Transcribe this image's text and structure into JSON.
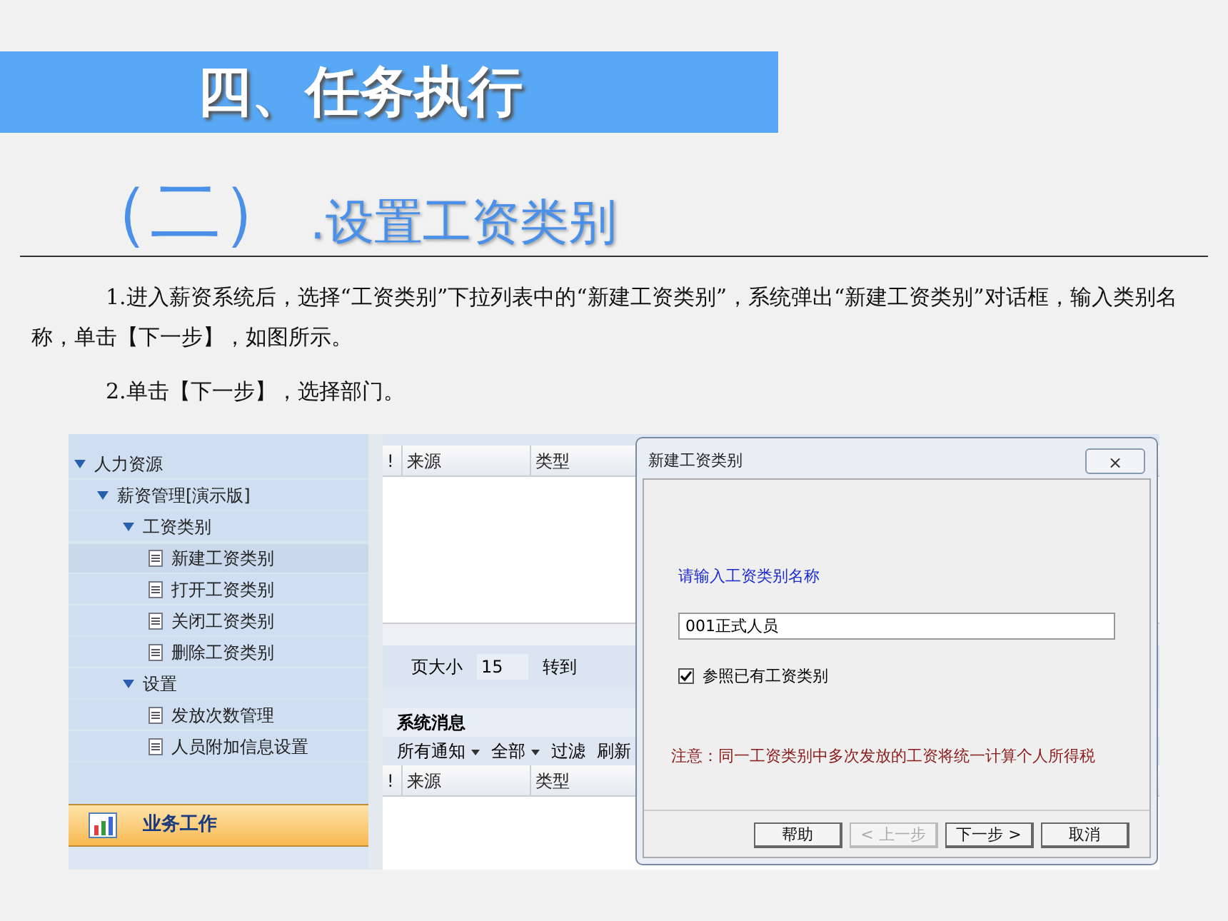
{
  "slide": {
    "title": "四、任务执行",
    "section_number": "（二）",
    "section_title": ".设置工资类别",
    "paragraphs": [
      "1.进入薪资系统后，选择“工资类别”下拉列表中的“新建工资类别”，系统弹出“新建工资类别”对话框，输入类别名称，单击【下一步】，如图所示。",
      "2.单击【下一步】，选择部门。"
    ]
  },
  "nav_tree": [
    {
      "label": "人力资源",
      "kind": "folder",
      "expanded": true,
      "selected": false,
      "children": [
        {
          "label": "薪资管理[演示版]",
          "kind": "folder",
          "expanded": true,
          "selected": false,
          "children": [
            {
              "label": "工资类别",
              "kind": "folder",
              "expanded": true,
              "selected": false,
              "children": [
                {
                  "label": "新建工资类别",
                  "kind": "leaf",
                  "selected": true
                },
                {
                  "label": "打开工资类别",
                  "kind": "leaf",
                  "selected": false
                },
                {
                  "label": "关闭工资类别",
                  "kind": "leaf",
                  "selected": false
                },
                {
                  "label": "删除工资类别",
                  "kind": "leaf",
                  "selected": false
                }
              ]
            },
            {
              "label": "设置",
              "kind": "folder",
              "expanded": true,
              "selected": false,
              "children": [
                {
                  "label": "发放次数管理",
                  "kind": "leaf",
                  "selected": false
                },
                {
                  "label": "人员附加信息设置",
                  "kind": "leaf",
                  "selected": false
                }
              ]
            }
          ]
        }
      ]
    }
  ],
  "nav_buttons": [
    {
      "label": "业务工作",
      "selected": true
    }
  ],
  "task_grid": {
    "columns": [
      "!",
      "来源",
      "类型"
    ]
  },
  "pager": {
    "page_size_label": "页大小",
    "page_size": "15",
    "goto_label": "转到"
  },
  "messages": {
    "title": "系统消息",
    "toolbar": [
      {
        "label": "所有通知",
        "kind": "dropdown"
      },
      {
        "label": "全部",
        "kind": "dropdown"
      },
      {
        "label": "过滤",
        "kind": "button"
      },
      {
        "label": "刷新",
        "kind": "button"
      }
    ],
    "columns": [
      "!",
      "来源",
      "类型"
    ]
  },
  "dialog": {
    "title": "新建工资类别",
    "close": "×",
    "prompt": "请输入工资类别名称",
    "value": "001正式人员",
    "checkbox": {
      "label": "参照已有工资类别",
      "checked": true
    },
    "note": "注意：同一工资类别中多次发放的工资将统一计算个人所得税",
    "buttons": [
      {
        "label": "帮助",
        "disabled": false
      },
      {
        "label": "< 上一步",
        "disabled": true
      },
      {
        "label": "下一步 >",
        "disabled": false
      },
      {
        "label": "取消",
        "disabled": false
      }
    ]
  }
}
